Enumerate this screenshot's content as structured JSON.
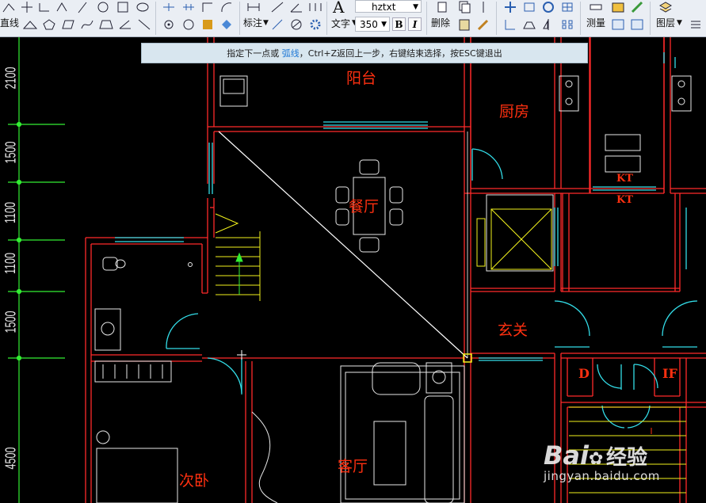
{
  "toolbar": {
    "line_label": "直线",
    "dimension_label": "标注",
    "text_label": "文字",
    "font_value": "hztxt",
    "size_value": "350",
    "bold_label": "B",
    "italic_label": "I",
    "delete_label": "删除",
    "measure_label": "测量",
    "layer_label": "图层"
  },
  "command_prompt": {
    "text_before": "指定下一点或 ",
    "highlight": "弧线",
    "text_after": "，Ctrl+Z返回上一步，右键结束选择，按ESC键退出",
    "highlight_color": "#1e78d6"
  },
  "drawing": {
    "rooms": {
      "balcony": "阳台",
      "kitchen": "厨房",
      "dining": "餐厅",
      "entrance": "玄关",
      "living": "客厅",
      "second_bedroom": "次卧"
    },
    "labels": {
      "kt1": "KT",
      "kt2": "KT",
      "d": "D",
      "if": "IF"
    },
    "dimensions": [
      "2100",
      "1500",
      "1100",
      "1100",
      "1500",
      "4500"
    ],
    "colors": {
      "wall": "#ff2a2a",
      "window": "#33dde8",
      "fixture": "#ffffff",
      "stair": "#f2f21c",
      "dimension": "#33ee33",
      "room_label": "#ff3010"
    }
  },
  "watermark": {
    "brand": "Bai",
    "brand2": "经验",
    "url": "jingyan.baidu.com"
  }
}
